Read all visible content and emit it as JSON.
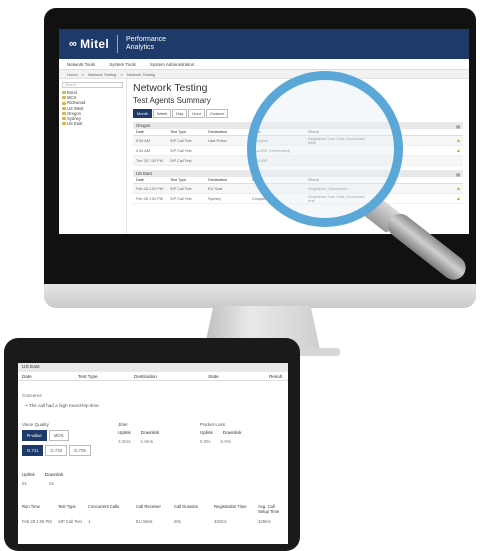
{
  "desktop": {
    "logo": "Mitel",
    "logo_mark": "∞",
    "product_line1": "Performance",
    "product_line2": "Analytics",
    "menu": [
      "Network Tools",
      "System Tools",
      "System Administration"
    ],
    "breadcrumbs": [
      "Home",
      ">",
      "Network Testing",
      ">",
      "Network Testing"
    ],
    "search_placeholder": "Search",
    "tree": [
      "Bond",
      "MCS",
      "Richwood",
      "US West",
      "Oregon",
      "Sydney",
      "US East"
    ],
    "page_title": "Network Testing",
    "section_title": "Test Agents Summary",
    "ranges": [
      "Month",
      "Week",
      "Day",
      "Hour",
      "Custom"
    ],
    "columns": [
      "Date",
      "Test Type",
      "Destination",
      "State",
      "Result"
    ],
    "groups": [
      {
        "name": "Oregon",
        "rows": [
          [
            "9:30 AM",
            "SIP Call Test",
            "Late Probe",
            "Complete",
            "Registered: true Calls Connected: false"
          ],
          [
            "2:04 AM",
            "SIP Call Test",
            "",
            "FAILURE (Unlicensed)",
            ""
          ],
          [
            "Tue 28 7:30 PM",
            "SIP Call Test",
            "",
            "FAILURE",
            ""
          ]
        ]
      },
      {
        "name": "US East",
        "rows": [
          [
            "Feb 28 1:00 PM",
            "SIP Call Test",
            "EU Seat",
            "",
            "Registered: Disconnect"
          ],
          [
            "Feb 28 1:00 PM",
            "SIP Call Test",
            "Sydney",
            "Complete",
            "Registered: true Calls Connected: true"
          ]
        ]
      }
    ]
  },
  "tablet": {
    "group": "US East",
    "columns": [
      "Date",
      "Test Type",
      "Destination",
      "State",
      "Result"
    ],
    "concerns_label": "Concerns",
    "concern": "The call had a high round-trip time.",
    "voice_quality_label": "Voice Quality",
    "vq_tabs": [
      "R-value",
      "MOS"
    ],
    "codecs": [
      "G.711",
      "G.722",
      "G.729"
    ],
    "jitter_label": "Jitter",
    "packet_loss_label": "Packet Loss",
    "uplink": "Uplink",
    "downlink": "Downlink",
    "jitter_values": [
      "3.0ms",
      "1.0ms"
    ],
    "loss_values": [
      "0.0%",
      "0.0%"
    ],
    "ud_values": [
      "91",
      "91"
    ],
    "run_headers": [
      "Run Time",
      "Test Type",
      "Concurrent Calls",
      "Call Receiver",
      "Call Duration",
      "Registration Time",
      "Avg. Call Setup Time"
    ],
    "run_values": [
      "Feb 28 1:00 PM",
      "SIP Call Test",
      "1",
      "EU West",
      "20s",
      "332ms",
      "329ms"
    ]
  }
}
